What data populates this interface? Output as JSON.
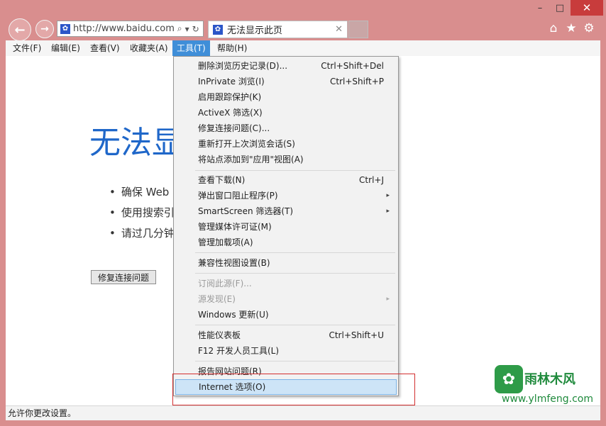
{
  "window": {
    "caption": {
      "minimize": "–",
      "maximize": "□",
      "close": "✕"
    }
  },
  "nav": {
    "back_glyph": "←",
    "forward_glyph": "→"
  },
  "address": {
    "url": "http://www.baidu.com",
    "search_glyph": "⌕",
    "dropdown_glyph": "▾",
    "refresh_glyph": "↻"
  },
  "tab": {
    "title": "无法显示此页",
    "close_glyph": "✕"
  },
  "toolbar": {
    "home_glyph": "⌂",
    "favorites_glyph": "★",
    "tools_glyph": "⚙"
  },
  "menubar": {
    "items": [
      {
        "label": "文件(F)"
      },
      {
        "label": "编辑(E)"
      },
      {
        "label": "查看(V)"
      },
      {
        "label": "收藏夹(A)"
      },
      {
        "label": "工具(T)"
      },
      {
        "label": "帮助(H)"
      }
    ]
  },
  "page": {
    "title": "无法显",
    "bullets": [
      "确保 Web",
      "使用搜索引",
      "请过几分钟"
    ],
    "fix_button": "修复连接问题"
  },
  "tools_menu": {
    "items": [
      {
        "label": "删除浏览历史记录(D)...",
        "shortcut": "Ctrl+Shift+Del"
      },
      {
        "label": "InPrivate 浏览(I)",
        "shortcut": "Ctrl+Shift+P"
      },
      {
        "label": "启用跟踪保护(K)"
      },
      {
        "label": "ActiveX 筛选(X)"
      },
      {
        "label": "修复连接问题(C)..."
      },
      {
        "label": "重新打开上次浏览会话(S)"
      },
      {
        "label": "将站点添加到\"应用\"视图(A)"
      },
      {
        "label": "查看下载(N)",
        "shortcut": "Ctrl+J"
      },
      {
        "label": "弹出窗口阻止程序(P)",
        "submenu": "▸"
      },
      {
        "label": "SmartScreen 筛选器(T)",
        "submenu": "▸"
      },
      {
        "label": "管理媒体许可证(M)"
      },
      {
        "label": "管理加载项(A)"
      },
      {
        "label": "兼容性视图设置(B)"
      },
      {
        "label": "订阅此源(F)..."
      },
      {
        "label": "源发现(E)",
        "submenu": "▸"
      },
      {
        "label": "Windows 更新(U)"
      },
      {
        "label": "性能仪表板",
        "shortcut": "Ctrl+Shift+U"
      },
      {
        "label": "F12 开发人员工具(L)"
      },
      {
        "label": "报告网站问题(R)"
      },
      {
        "label": "Internet 选项(O)"
      }
    ]
  },
  "status": {
    "text": "允许你更改设置。"
  },
  "watermark": {
    "logo_glyph": "✿",
    "title": "雨林木风",
    "url": "www.ylmfeng.com"
  },
  "colors": {
    "accent": "#3f8ed8",
    "title_blue": "#1f67c9",
    "frame": "#d98e8e",
    "highlight": "#cde4f7",
    "annotation": "#d32f2f"
  }
}
